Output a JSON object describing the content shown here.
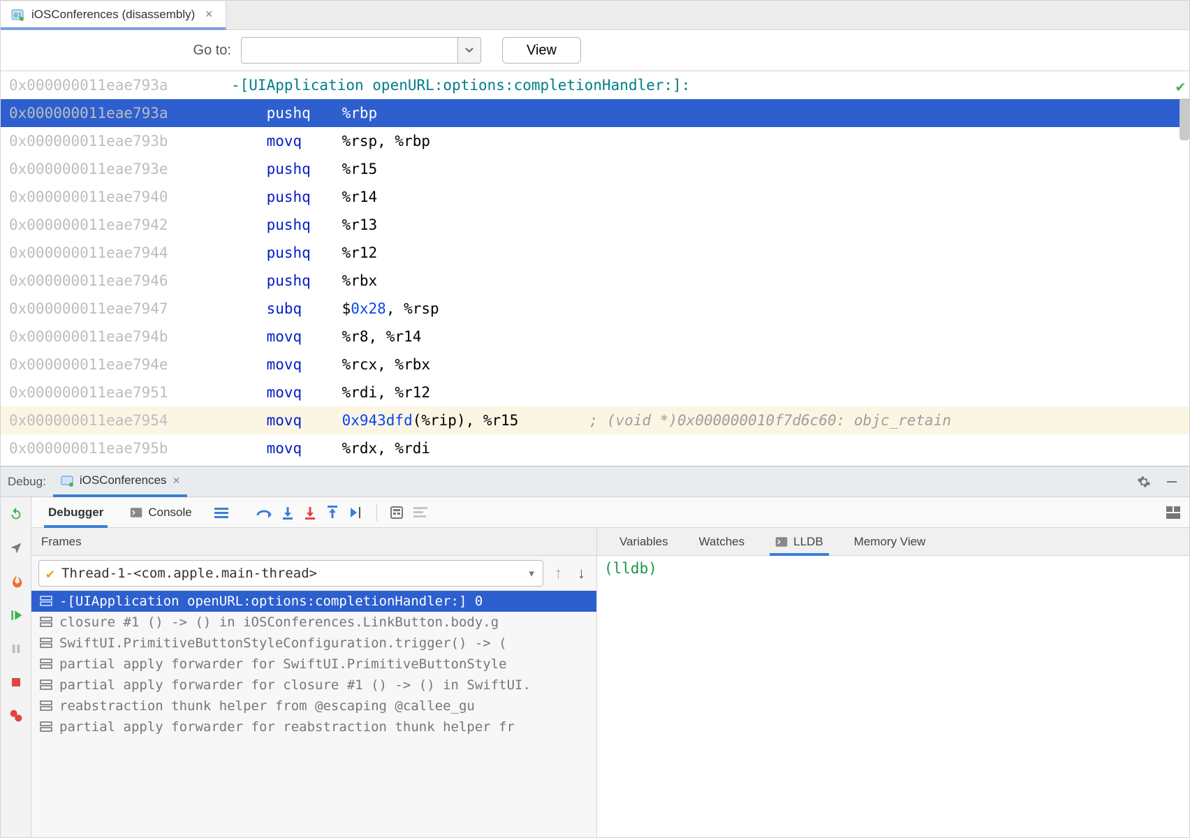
{
  "editor_tab": {
    "title": "iOSConferences (disassembly)"
  },
  "goto": {
    "label": "Go to:",
    "value": "",
    "view_label": "View"
  },
  "disassembly": {
    "header_addr": "0x000000011eae793a",
    "header_text": "-[UIApplication openURL:options:completionHandler:]:",
    "rows": [
      {
        "addr": "0x000000011eae793a",
        "mnem": "pushq",
        "ops": "%rbp",
        "selected": true
      },
      {
        "addr": "0x000000011eae793b",
        "mnem": "movq",
        "ops": "%rsp, %rbp"
      },
      {
        "addr": "0x000000011eae793e",
        "mnem": "pushq",
        "ops": "%r15"
      },
      {
        "addr": "0x000000011eae7940",
        "mnem": "pushq",
        "ops": "%r14"
      },
      {
        "addr": "0x000000011eae7942",
        "mnem": "pushq",
        "ops": "%r13"
      },
      {
        "addr": "0x000000011eae7944",
        "mnem": "pushq",
        "ops": "%r12"
      },
      {
        "addr": "0x000000011eae7946",
        "mnem": "pushq",
        "ops": "%rbx"
      },
      {
        "addr": "0x000000011eae7947",
        "mnem": "subq",
        "ops_pre": "$",
        "num": "0x28",
        "ops_post": ", %rsp"
      },
      {
        "addr": "0x000000011eae794b",
        "mnem": "movq",
        "ops": "%r8, %r14"
      },
      {
        "addr": "0x000000011eae794e",
        "mnem": "movq",
        "ops": "%rcx, %rbx"
      },
      {
        "addr": "0x000000011eae7951",
        "mnem": "movq",
        "ops": "%rdi, %r12"
      },
      {
        "addr": "0x000000011eae7954",
        "mnem": "movq",
        "num": "0x943dfd",
        "ops_post": "(%rip), %r15",
        "comment": "; (void *)0x000000010f7d6c60: objc_retain",
        "highlight": true
      },
      {
        "addr": "0x000000011eae795b",
        "mnem": "movq",
        "ops": "%rdx, %rdi"
      }
    ]
  },
  "debug": {
    "label": "Debug:",
    "session": "iOSConferences",
    "tabs": {
      "debugger": "Debugger",
      "console": "Console"
    },
    "frames_label": "Frames",
    "thread": "Thread-1-<com.apple.main-thread>",
    "frames": [
      "-[UIApplication openURL:options:completionHandler:] 0",
      "closure #1 () -> () in iOSConferences.LinkButton.body.g",
      "SwiftUI.PrimitiveButtonStyleConfiguration.trigger() -> (",
      "partial apply forwarder for SwiftUI.PrimitiveButtonStyle",
      "partial apply forwarder for closure #1 () -> () in SwiftUI.",
      "reabstraction thunk helper from @escaping @callee_gu",
      "partial apply forwarder for reabstraction thunk helper fr"
    ],
    "var_tabs": {
      "variables": "Variables",
      "watches": "Watches",
      "lldb": "LLDB",
      "memory": "Memory View"
    },
    "lldb_prompt": "(lldb)"
  }
}
